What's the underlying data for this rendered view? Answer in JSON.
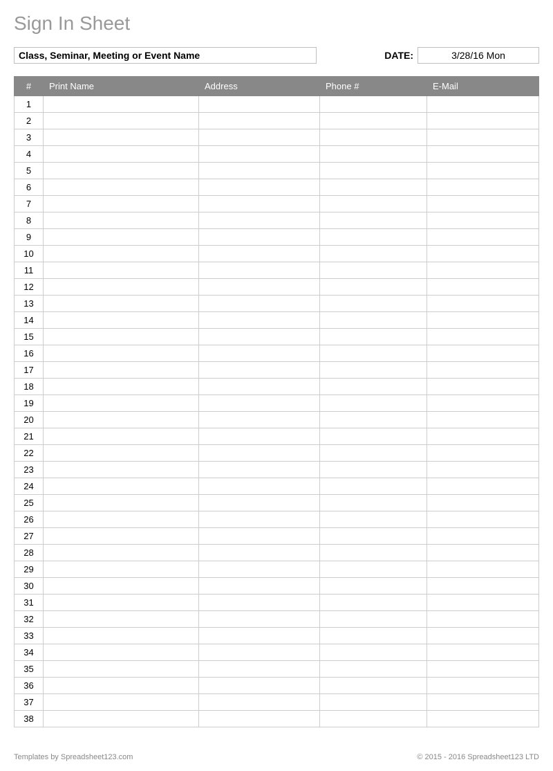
{
  "title": "Sign In Sheet",
  "event_name_placeholder": "Class, Seminar, Meeting or Event Name",
  "date_label": "DATE:",
  "date_value": "3/28/16 Mon",
  "columns": {
    "num": "#",
    "name": "Print Name",
    "address": "Address",
    "phone": "Phone #",
    "email": "E-Mail"
  },
  "row_count": 38,
  "footer": {
    "left": "Templates by Spreadsheet123.com",
    "right": "© 2015 - 2016 Spreadsheet123 LTD"
  }
}
